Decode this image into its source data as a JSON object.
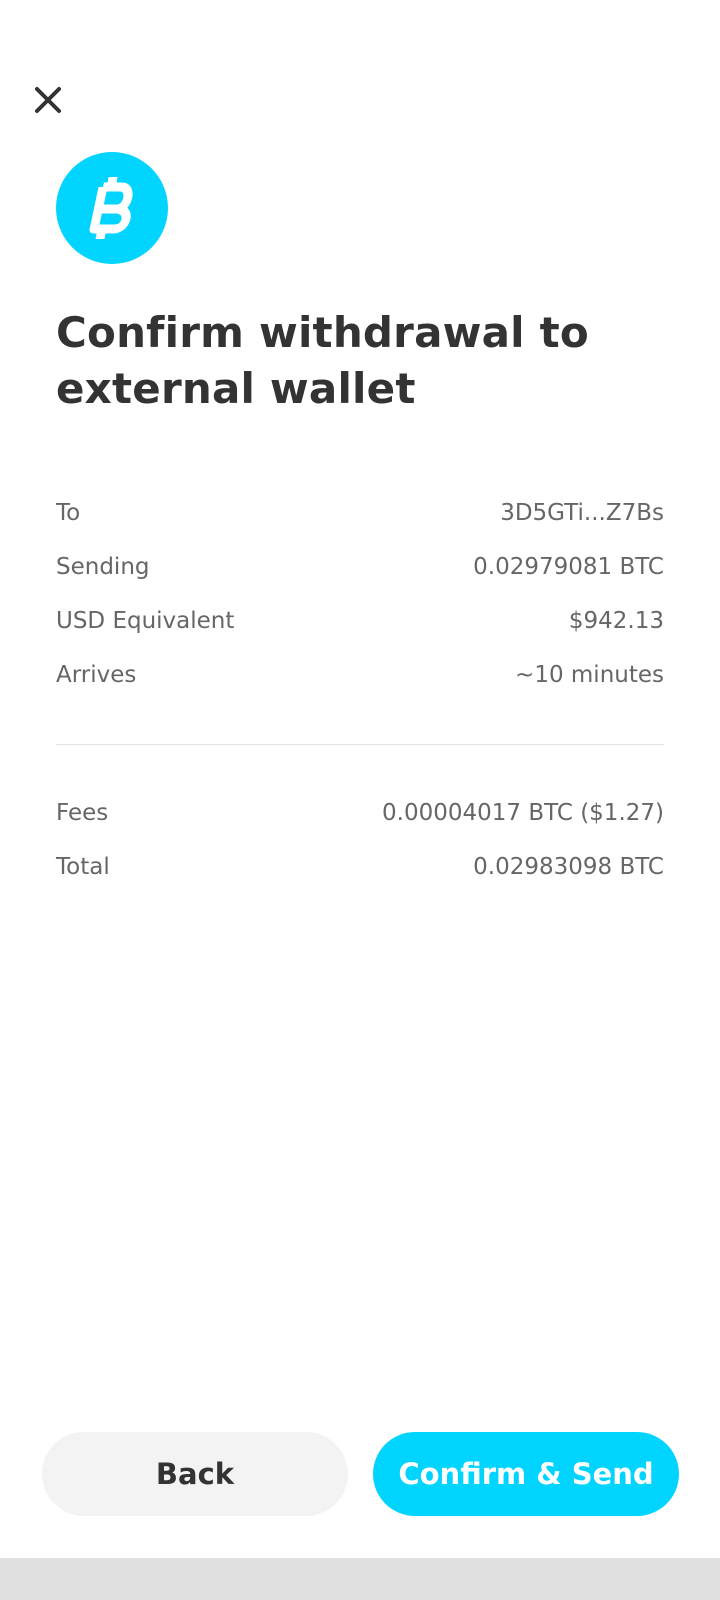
{
  "header": {
    "close_icon": "close-icon",
    "currency_icon": "bitcoin-icon",
    "accent_color": "#00d4ff",
    "title": "Confirm withdrawal to external wallet"
  },
  "details": [
    {
      "label": "To",
      "value": "3D5GTi...Z7Bs"
    },
    {
      "label": "Sending",
      "value": "0.02979081 BTC"
    },
    {
      "label": "USD Equivalent",
      "value": "$942.13"
    },
    {
      "label": "Arrives",
      "value": "~10 minutes"
    }
  ],
  "summary": [
    {
      "label": "Fees",
      "value": "0.00004017 BTC ($1.27)"
    },
    {
      "label": "Total",
      "value": "0.02983098 BTC"
    }
  ],
  "actions": {
    "back_label": "Back",
    "confirm_label": "Confirm & Send"
  }
}
